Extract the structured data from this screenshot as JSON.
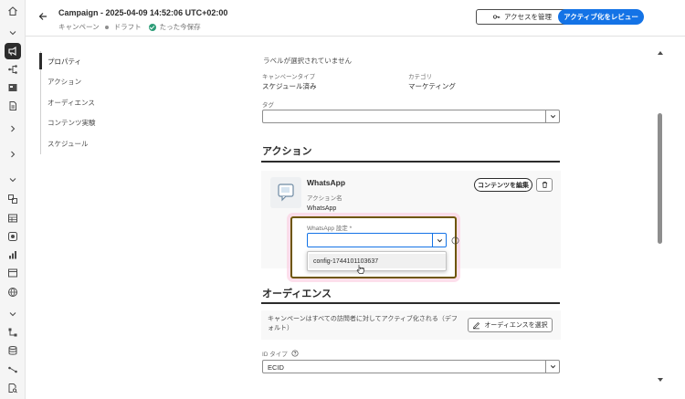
{
  "header": {
    "title": "Campaign - 2025-04-09 14:52:06 UTC+02:00",
    "type": "キャンペーン",
    "status": "ドラフト",
    "saved": "たった今保存",
    "access_button": "アクセスを管理",
    "activate_button": "アクティブ化をレビュー"
  },
  "rail_icons": [
    "home-icon",
    "chevron-down-icon",
    "campaign-icon",
    "journey-icon",
    "content-icon",
    "document-icon",
    "chevron-right-icon",
    "chevron-right-icon",
    "chevron-down-icon",
    "components-icon",
    "table-icon",
    "decision-icon",
    "chart-icon",
    "library-icon",
    "globe-icon",
    "chevron-down-icon",
    "flow-icon",
    "database-icon",
    "connection-icon",
    "search-document-icon"
  ],
  "subnav": {
    "items": [
      "プロパティ",
      "アクション",
      "オーディエンス",
      "コンテンツ実験",
      "スケジュール"
    ]
  },
  "properties": {
    "no_labels": "ラベルが選択されていません",
    "campaign_type_label": "キャンペーンタイプ",
    "campaign_type_value": "スケジュール済み",
    "category_label": "カテゴリ",
    "category_value": "マーケティング",
    "tag_label": "タグ",
    "tag_value": ""
  },
  "action": {
    "section_title": "アクション",
    "channel_title": "WhatsApp",
    "action_name_label": "アクション名",
    "action_name_value": "WhatsApp",
    "edit_content_button": "コンテンツを編集",
    "config_label": "WhatsApp 設定",
    "required_mark": "*",
    "config_value": "",
    "dropdown_option": "config-1744101103637"
  },
  "audience": {
    "section_title": "オーディエンス",
    "description": "キャンペーンはすべての訪問者に対してアクティブ化される（デフォルト）",
    "select_button": "オーディエンスを選択",
    "id_type_label": "ID タイプ",
    "id_type_value": "ECID"
  },
  "colors": {
    "accent": "#1473e6",
    "success": "#2d9d78",
    "highlight_border": "#6e5600",
    "highlight_glow": "#fcc4dc"
  }
}
